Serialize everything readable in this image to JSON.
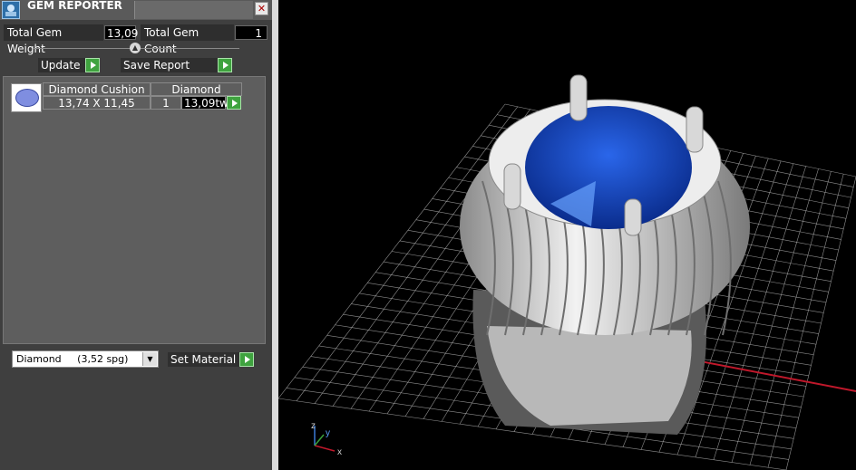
{
  "window": {
    "title": "GEM REPORTER",
    "close_icon": "close-icon"
  },
  "stats": {
    "weight_label": "Total Gem Weight",
    "weight_value": "13,09",
    "count_label": "Total Gem Count",
    "count_value": "1"
  },
  "toolbar": {
    "update_label": "Update",
    "save_report_label": "Save Report"
  },
  "gem_list": {
    "header": [
      "Diamond Cushion",
      "Diamond"
    ],
    "items": [
      {
        "dimensions": "13,74 X 11,45",
        "quantity": "1",
        "weight": "13,09tw"
      }
    ]
  },
  "material": {
    "selected_name": "Diamond",
    "selected_density": "(3,52 spg)",
    "set_label": "Set Material"
  },
  "viewport": {
    "axis_labels": [
      "z",
      "y",
      "x"
    ],
    "colors": {
      "gem": "#1f55d8",
      "metal": "#d6d6d6",
      "grid": "#bfbfbf",
      "x_axis": "#c0182b"
    }
  }
}
